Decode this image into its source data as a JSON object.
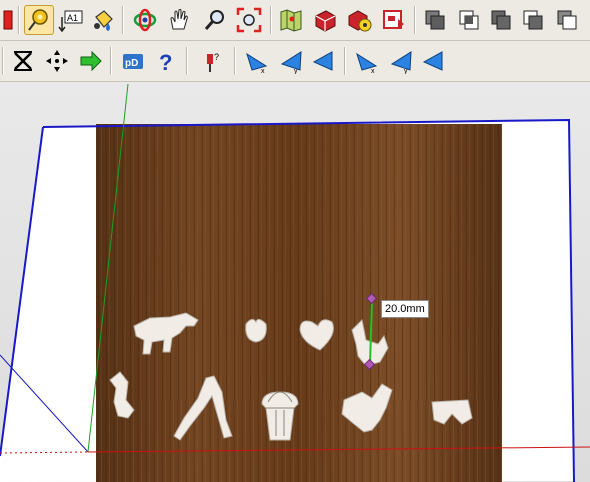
{
  "toolbar_top": {
    "buttons": [
      {
        "icon": "tape-measure-icon",
        "active": true
      },
      {
        "icon": "text-icon",
        "label": "A1"
      },
      {
        "icon": "paint-bucket-icon"
      },
      {
        "icon": "orbit-icon"
      },
      {
        "icon": "pan-hand-icon"
      },
      {
        "icon": "zoom-icon"
      },
      {
        "icon": "zoom-extents-icon"
      },
      {
        "icon": "map-icon"
      },
      {
        "icon": "get-models-icon"
      },
      {
        "icon": "share-model-icon"
      },
      {
        "icon": "component-warehouse-icon"
      },
      {
        "icon": "solid-outer-shell-icon"
      },
      {
        "icon": "solid-intersect-icon"
      },
      {
        "icon": "solid-union-icon"
      },
      {
        "icon": "solid-subtract-icon"
      },
      {
        "icon": "solid-trim-icon"
      }
    ]
  },
  "toolbar_bottom": {
    "buttons": [
      {
        "icon": "x-close-icon"
      },
      {
        "icon": "explode-icon"
      },
      {
        "icon": "arrow-right-icon"
      },
      {
        "icon": "model-info-icon",
        "label": "pD"
      },
      {
        "icon": "help-icon",
        "label": "?"
      },
      {
        "icon": "pushpin-question-icon"
      },
      {
        "icon": "section-x-icon"
      },
      {
        "icon": "section-y-icon"
      },
      {
        "icon": "section-z-icon"
      },
      {
        "icon": "section-x2-icon"
      },
      {
        "icon": "section-y2-icon"
      },
      {
        "icon": "section-z2-icon"
      }
    ]
  },
  "viewport": {
    "dimension_label": "20.0mm",
    "axis_colors": {
      "green": "#1ea01e",
      "red": "#cc1111",
      "blue": "#1919c8"
    }
  }
}
